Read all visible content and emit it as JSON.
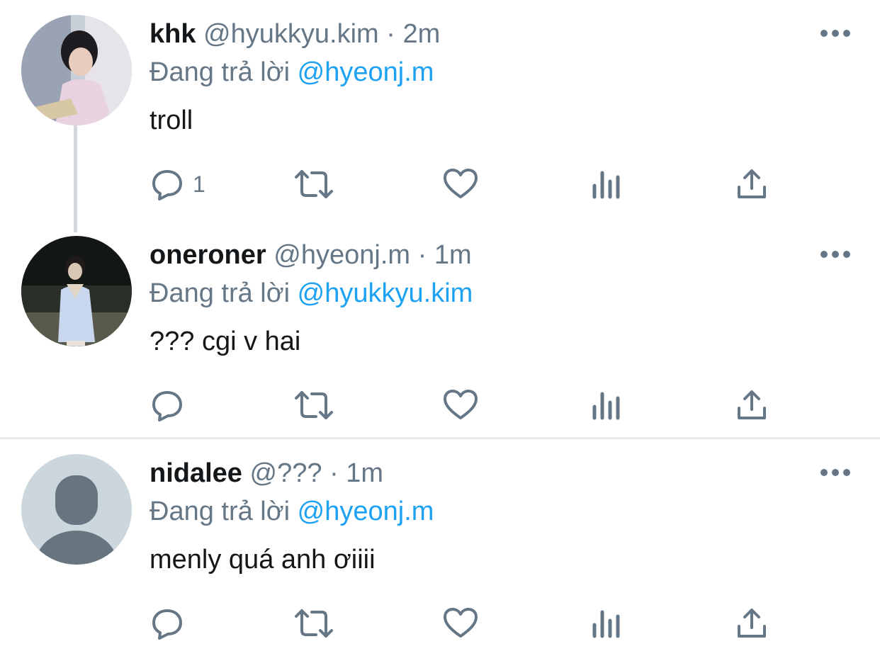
{
  "tweets": [
    {
      "name": "khk",
      "handle": "@hyukkyu.kim",
      "separator": "·",
      "time": "2m",
      "replying_prefix": "Đang trả lời",
      "replying_to": "@hyeonj.m",
      "text": "troll",
      "reply_count": "1",
      "avatar": "photo"
    },
    {
      "name": "oneroner",
      "handle": "@hyeonj.m",
      "separator": "·",
      "time": "1m",
      "replying_prefix": "Đang trả lời",
      "replying_to": "@hyukkyu.kim",
      "text": "??? cgi v hai",
      "reply_count": "",
      "avatar": "photo"
    },
    {
      "name": "nidalee",
      "handle": "@???",
      "separator": "·",
      "time": "1m",
      "replying_prefix": "Đang trả lời",
      "replying_to": "@hyeonj.m",
      "text": "menly quá anh ơiiii",
      "reply_count": "",
      "avatar": "default-profile"
    }
  ],
  "icons": {
    "reply": "speech-bubble-icon",
    "retweet": "retweet-icon",
    "like": "heart-icon",
    "stats": "analytics-icon",
    "share": "share-icon",
    "more": "more-dots-icon"
  },
  "colors": {
    "name": "#14171a",
    "secondary": "#657786",
    "mention": "#1da1f2",
    "divider": "#e6ecf0"
  }
}
